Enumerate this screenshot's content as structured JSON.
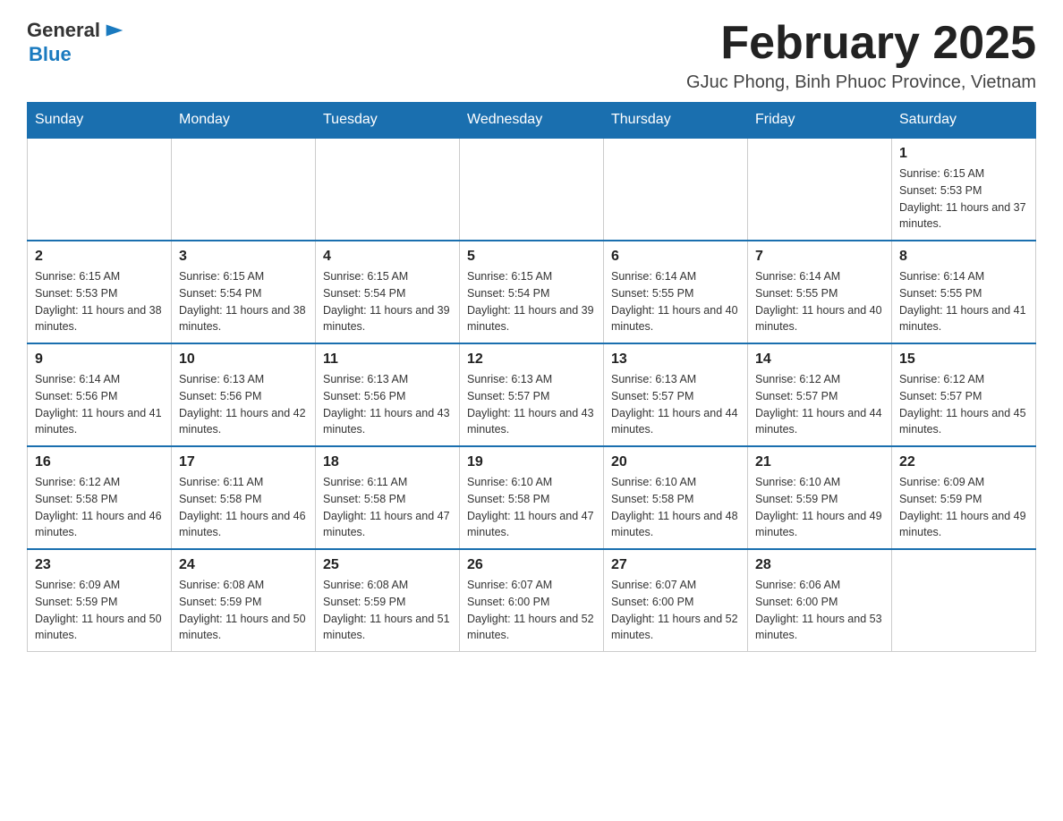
{
  "header": {
    "logo": {
      "text_general": "General",
      "text_blue": "Blue",
      "icon": "▶"
    },
    "title": "February 2025",
    "subtitle": "GJuc Phong, Binh Phuoc Province, Vietnam"
  },
  "weekdays": [
    "Sunday",
    "Monday",
    "Tuesday",
    "Wednesday",
    "Thursday",
    "Friday",
    "Saturday"
  ],
  "weeks": [
    [
      {
        "day": "",
        "info": ""
      },
      {
        "day": "",
        "info": ""
      },
      {
        "day": "",
        "info": ""
      },
      {
        "day": "",
        "info": ""
      },
      {
        "day": "",
        "info": ""
      },
      {
        "day": "",
        "info": ""
      },
      {
        "day": "1",
        "info": "Sunrise: 6:15 AM\nSunset: 5:53 PM\nDaylight: 11 hours and 37 minutes."
      }
    ],
    [
      {
        "day": "2",
        "info": "Sunrise: 6:15 AM\nSunset: 5:53 PM\nDaylight: 11 hours and 38 minutes."
      },
      {
        "day": "3",
        "info": "Sunrise: 6:15 AM\nSunset: 5:54 PM\nDaylight: 11 hours and 38 minutes."
      },
      {
        "day": "4",
        "info": "Sunrise: 6:15 AM\nSunset: 5:54 PM\nDaylight: 11 hours and 39 minutes."
      },
      {
        "day": "5",
        "info": "Sunrise: 6:15 AM\nSunset: 5:54 PM\nDaylight: 11 hours and 39 minutes."
      },
      {
        "day": "6",
        "info": "Sunrise: 6:14 AM\nSunset: 5:55 PM\nDaylight: 11 hours and 40 minutes."
      },
      {
        "day": "7",
        "info": "Sunrise: 6:14 AM\nSunset: 5:55 PM\nDaylight: 11 hours and 40 minutes."
      },
      {
        "day": "8",
        "info": "Sunrise: 6:14 AM\nSunset: 5:55 PM\nDaylight: 11 hours and 41 minutes."
      }
    ],
    [
      {
        "day": "9",
        "info": "Sunrise: 6:14 AM\nSunset: 5:56 PM\nDaylight: 11 hours and 41 minutes."
      },
      {
        "day": "10",
        "info": "Sunrise: 6:13 AM\nSunset: 5:56 PM\nDaylight: 11 hours and 42 minutes."
      },
      {
        "day": "11",
        "info": "Sunrise: 6:13 AM\nSunset: 5:56 PM\nDaylight: 11 hours and 43 minutes."
      },
      {
        "day": "12",
        "info": "Sunrise: 6:13 AM\nSunset: 5:57 PM\nDaylight: 11 hours and 43 minutes."
      },
      {
        "day": "13",
        "info": "Sunrise: 6:13 AM\nSunset: 5:57 PM\nDaylight: 11 hours and 44 minutes."
      },
      {
        "day": "14",
        "info": "Sunrise: 6:12 AM\nSunset: 5:57 PM\nDaylight: 11 hours and 44 minutes."
      },
      {
        "day": "15",
        "info": "Sunrise: 6:12 AM\nSunset: 5:57 PM\nDaylight: 11 hours and 45 minutes."
      }
    ],
    [
      {
        "day": "16",
        "info": "Sunrise: 6:12 AM\nSunset: 5:58 PM\nDaylight: 11 hours and 46 minutes."
      },
      {
        "day": "17",
        "info": "Sunrise: 6:11 AM\nSunset: 5:58 PM\nDaylight: 11 hours and 46 minutes."
      },
      {
        "day": "18",
        "info": "Sunrise: 6:11 AM\nSunset: 5:58 PM\nDaylight: 11 hours and 47 minutes."
      },
      {
        "day": "19",
        "info": "Sunrise: 6:10 AM\nSunset: 5:58 PM\nDaylight: 11 hours and 47 minutes."
      },
      {
        "day": "20",
        "info": "Sunrise: 6:10 AM\nSunset: 5:58 PM\nDaylight: 11 hours and 48 minutes."
      },
      {
        "day": "21",
        "info": "Sunrise: 6:10 AM\nSunset: 5:59 PM\nDaylight: 11 hours and 49 minutes."
      },
      {
        "day": "22",
        "info": "Sunrise: 6:09 AM\nSunset: 5:59 PM\nDaylight: 11 hours and 49 minutes."
      }
    ],
    [
      {
        "day": "23",
        "info": "Sunrise: 6:09 AM\nSunset: 5:59 PM\nDaylight: 11 hours and 50 minutes."
      },
      {
        "day": "24",
        "info": "Sunrise: 6:08 AM\nSunset: 5:59 PM\nDaylight: 11 hours and 50 minutes."
      },
      {
        "day": "25",
        "info": "Sunrise: 6:08 AM\nSunset: 5:59 PM\nDaylight: 11 hours and 51 minutes."
      },
      {
        "day": "26",
        "info": "Sunrise: 6:07 AM\nSunset: 6:00 PM\nDaylight: 11 hours and 52 minutes."
      },
      {
        "day": "27",
        "info": "Sunrise: 6:07 AM\nSunset: 6:00 PM\nDaylight: 11 hours and 52 minutes."
      },
      {
        "day": "28",
        "info": "Sunrise: 6:06 AM\nSunset: 6:00 PM\nDaylight: 11 hours and 53 minutes."
      },
      {
        "day": "",
        "info": ""
      }
    ]
  ]
}
